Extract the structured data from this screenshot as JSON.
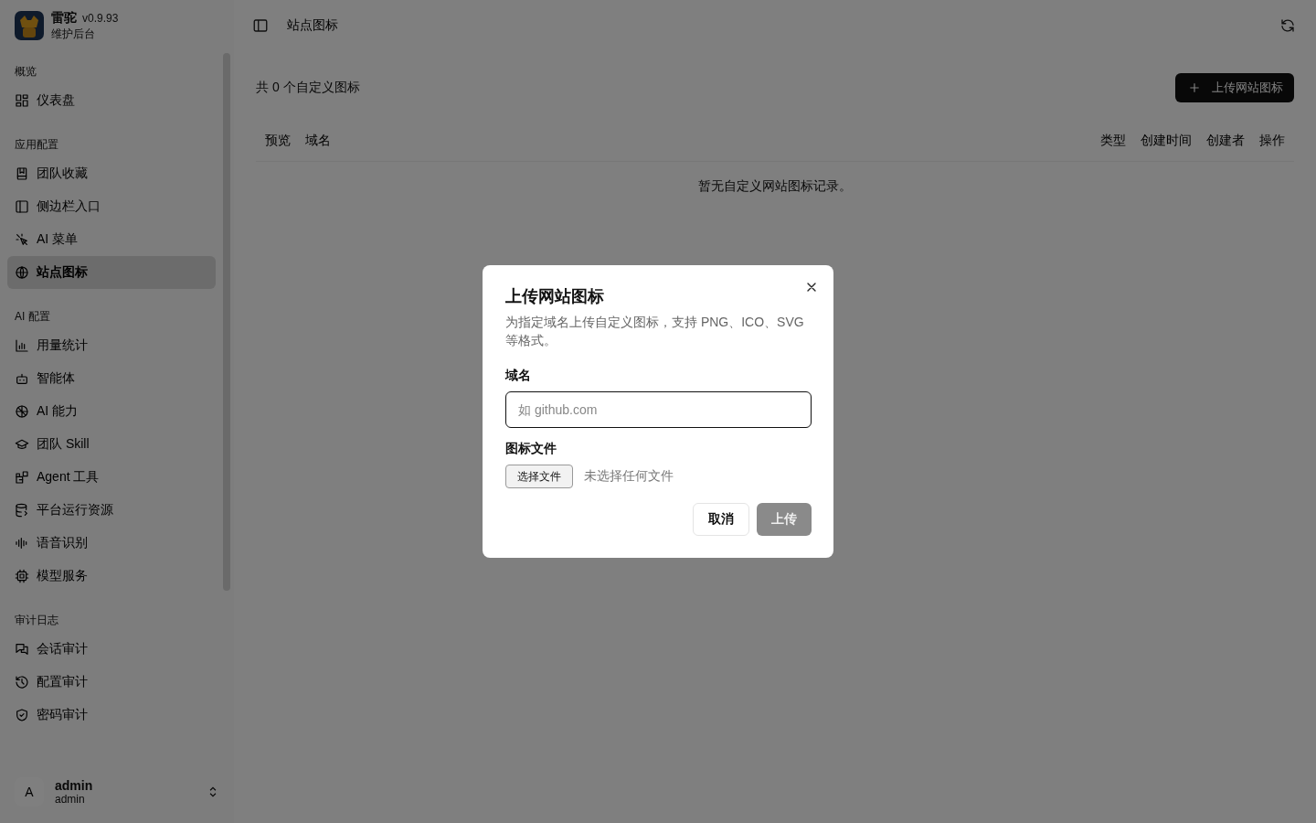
{
  "app": {
    "name": "雷驼",
    "version": "v0.9.93",
    "subtitle": "维护后台"
  },
  "sidebar": {
    "groups": [
      {
        "label": "概览",
        "items": [
          {
            "label": "仪表盘",
            "selected": false
          }
        ]
      },
      {
        "label": "应用配置",
        "items": [
          {
            "label": "团队收藏",
            "selected": false
          },
          {
            "label": "侧边栏入口",
            "selected": false
          },
          {
            "label": "AI 菜单",
            "selected": false
          },
          {
            "label": "站点图标",
            "selected": true
          }
        ]
      },
      {
        "label": "AI 配置",
        "items": [
          {
            "label": "用量统计",
            "selected": false
          },
          {
            "label": "智能体",
            "selected": false
          },
          {
            "label": "AI 能力",
            "selected": false
          },
          {
            "label": "团队 Skill",
            "selected": false
          },
          {
            "label": "Agent 工具",
            "selected": false
          },
          {
            "label": "平台运行资源",
            "selected": false
          },
          {
            "label": "语音识别",
            "selected": false
          },
          {
            "label": "模型服务",
            "selected": false
          }
        ]
      },
      {
        "label": "审计日志",
        "items": [
          {
            "label": "会话审计",
            "selected": false
          },
          {
            "label": "配置审计",
            "selected": false
          },
          {
            "label": "密码审计",
            "selected": false
          }
        ]
      }
    ]
  },
  "user": {
    "avatar": "A",
    "name": "admin",
    "role": "admin"
  },
  "header": {
    "title": "站点图标"
  },
  "toolbar": {
    "count": "共 0 个自定义图标",
    "upload_button": "上传网站图标"
  },
  "table": {
    "columns": [
      "预览",
      "域名",
      "类型",
      "创建时间",
      "创建者",
      "操作"
    ],
    "empty": "暂无自定义网站图标记录。"
  },
  "dialog": {
    "title": "上传网站图标",
    "description": "为指定域名上传自定义图标，支持 PNG、ICO、SVG 等格式。",
    "domain": {
      "label": "域名",
      "placeholder": "如 github.com"
    },
    "file": {
      "label": "图标文件",
      "button": "选择文件",
      "status": "未选择任何文件"
    },
    "cancel": "取消",
    "submit": {
      "label": "上传",
      "disabled": true
    }
  }
}
